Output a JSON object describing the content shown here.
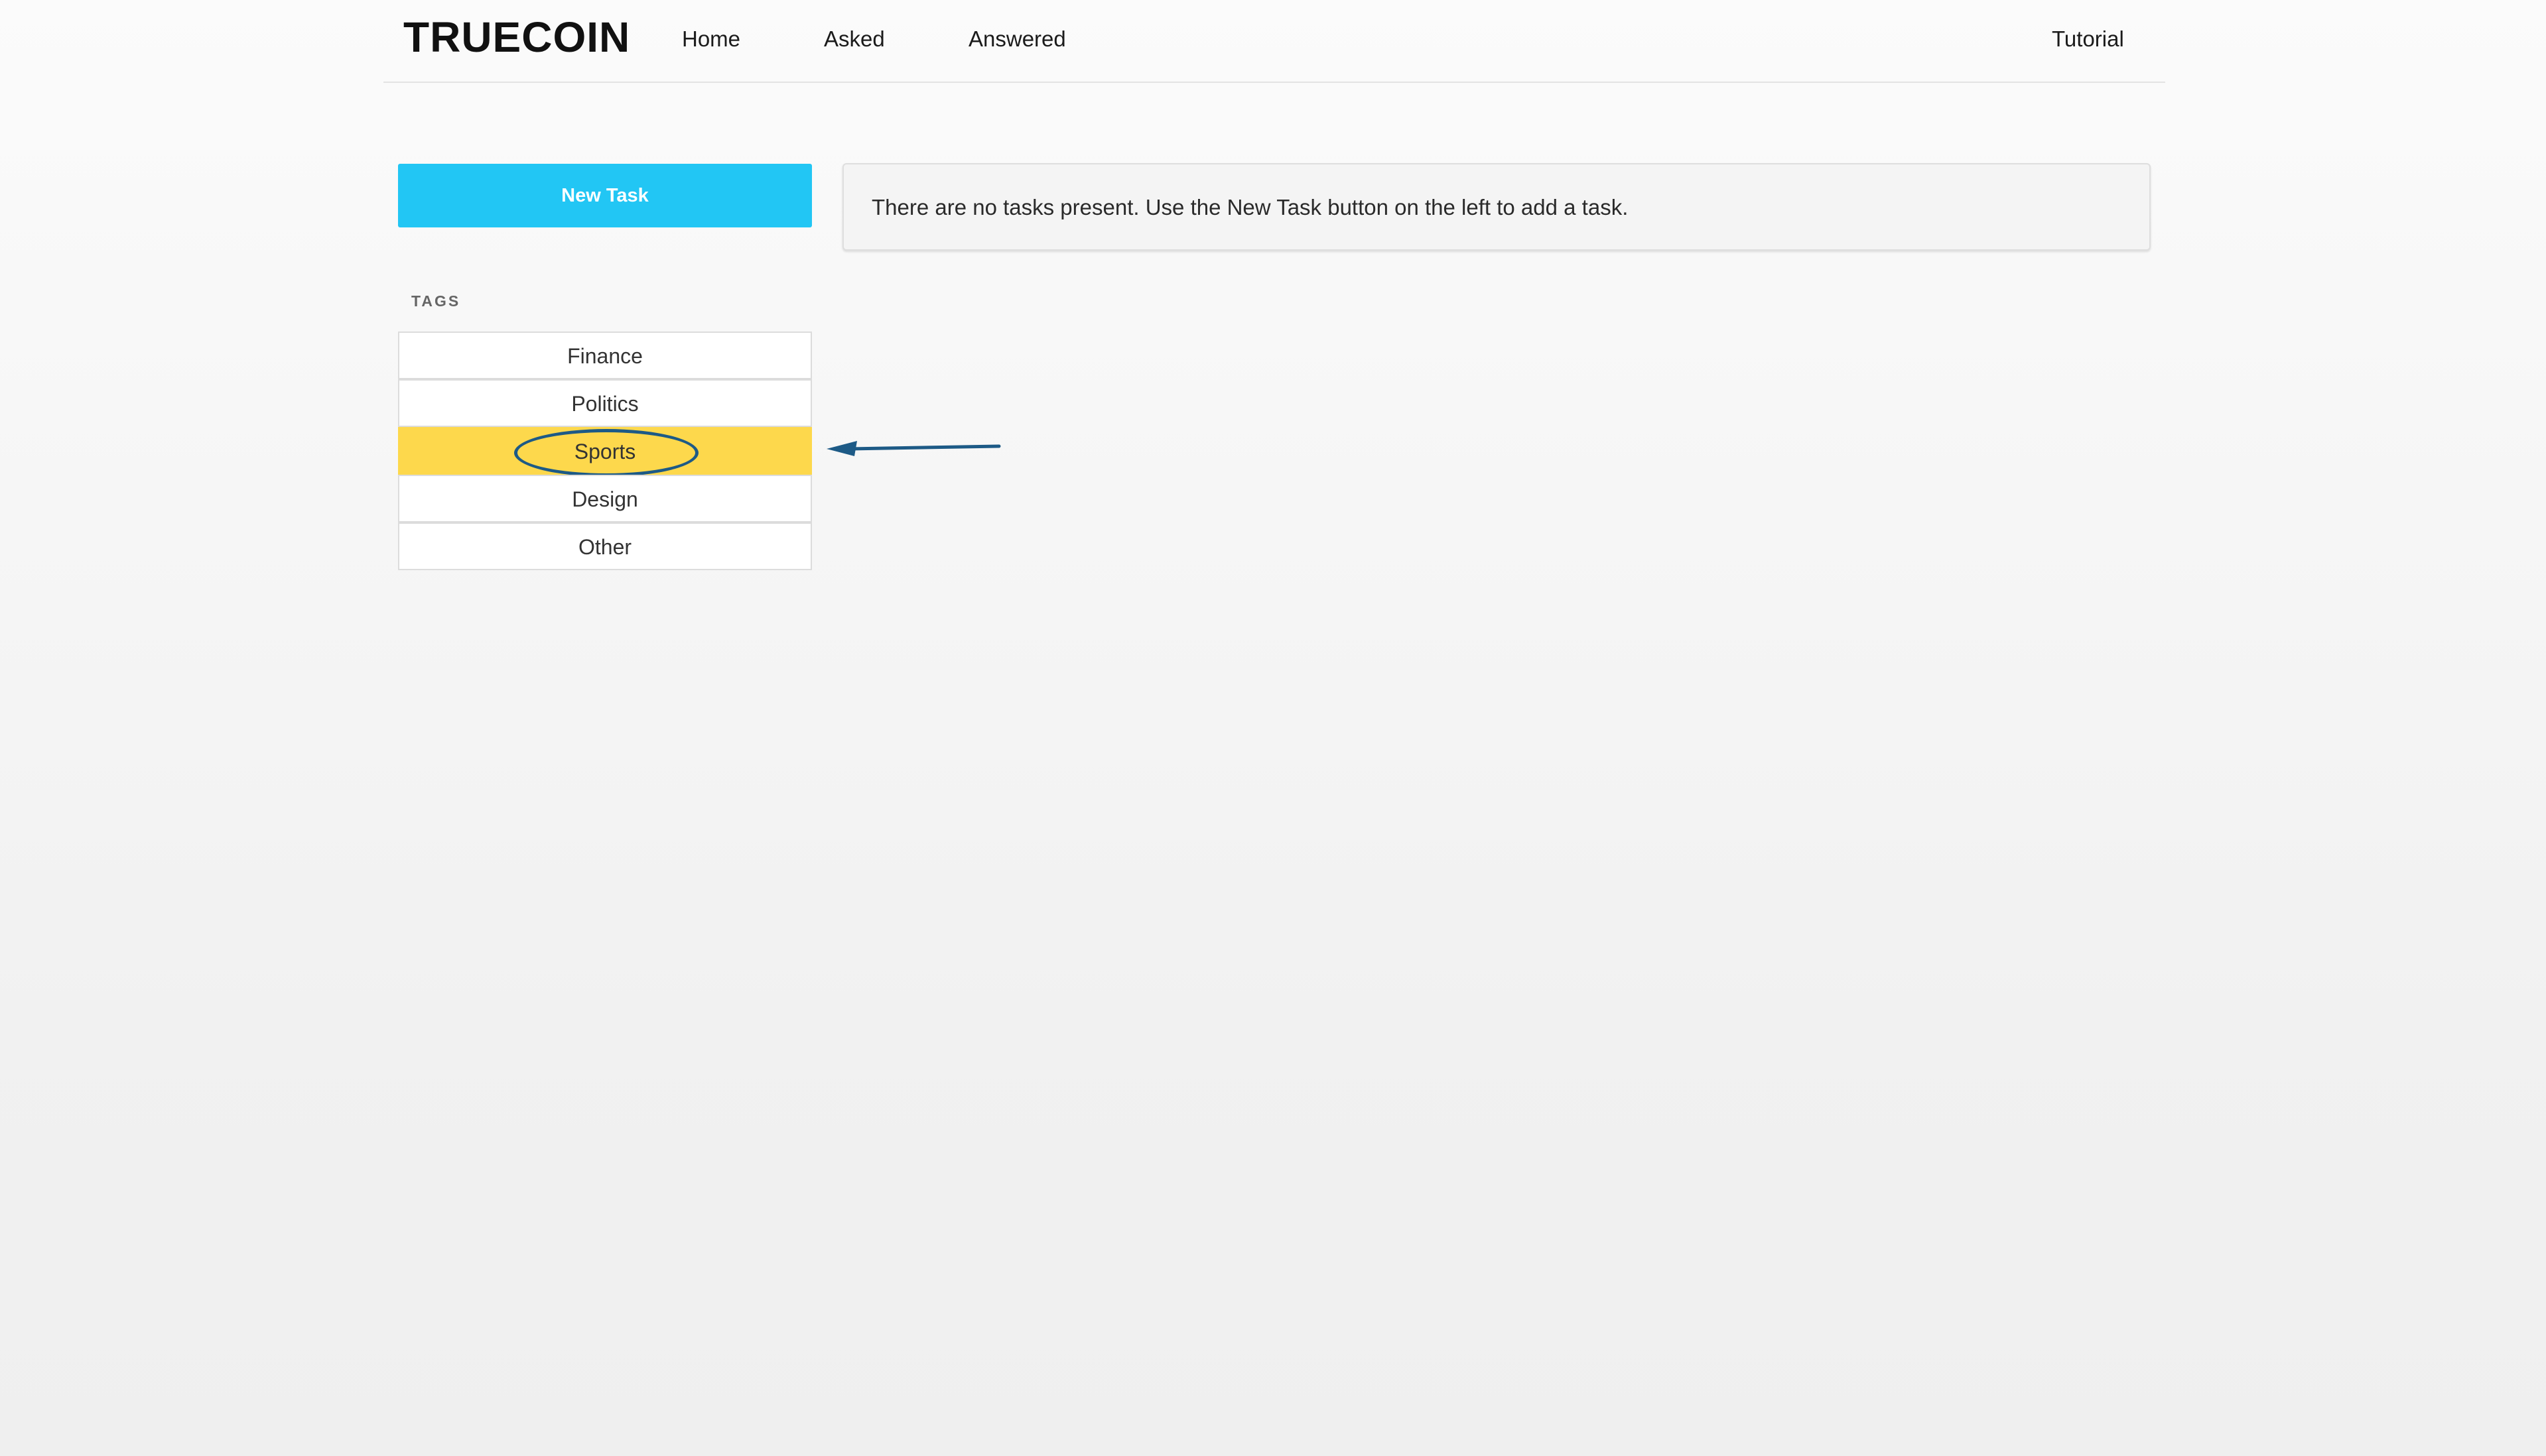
{
  "navbar": {
    "brand": "TRUECOIN",
    "links": [
      {
        "label": "Home"
      },
      {
        "label": "Asked"
      },
      {
        "label": "Answered"
      }
    ],
    "right_link": "Tutorial"
  },
  "sidebar": {
    "new_task_label": "New Task",
    "tags_heading": "TAGS",
    "tags": [
      {
        "label": "Finance",
        "active": false
      },
      {
        "label": "Politics",
        "active": false
      },
      {
        "label": "Sports",
        "active": true
      },
      {
        "label": "Design",
        "active": false
      },
      {
        "label": "Other",
        "active": false
      }
    ]
  },
  "main": {
    "notice": "There are no tasks present. Use the New Task button on the left to add a task."
  },
  "annotation": {
    "highlight_target": "Sports",
    "circle_color": "#1d5a86",
    "arrow_color": "#1d5a86"
  },
  "colors": {
    "accent": "#22c6f4",
    "active_tag": "#fdd84c"
  }
}
